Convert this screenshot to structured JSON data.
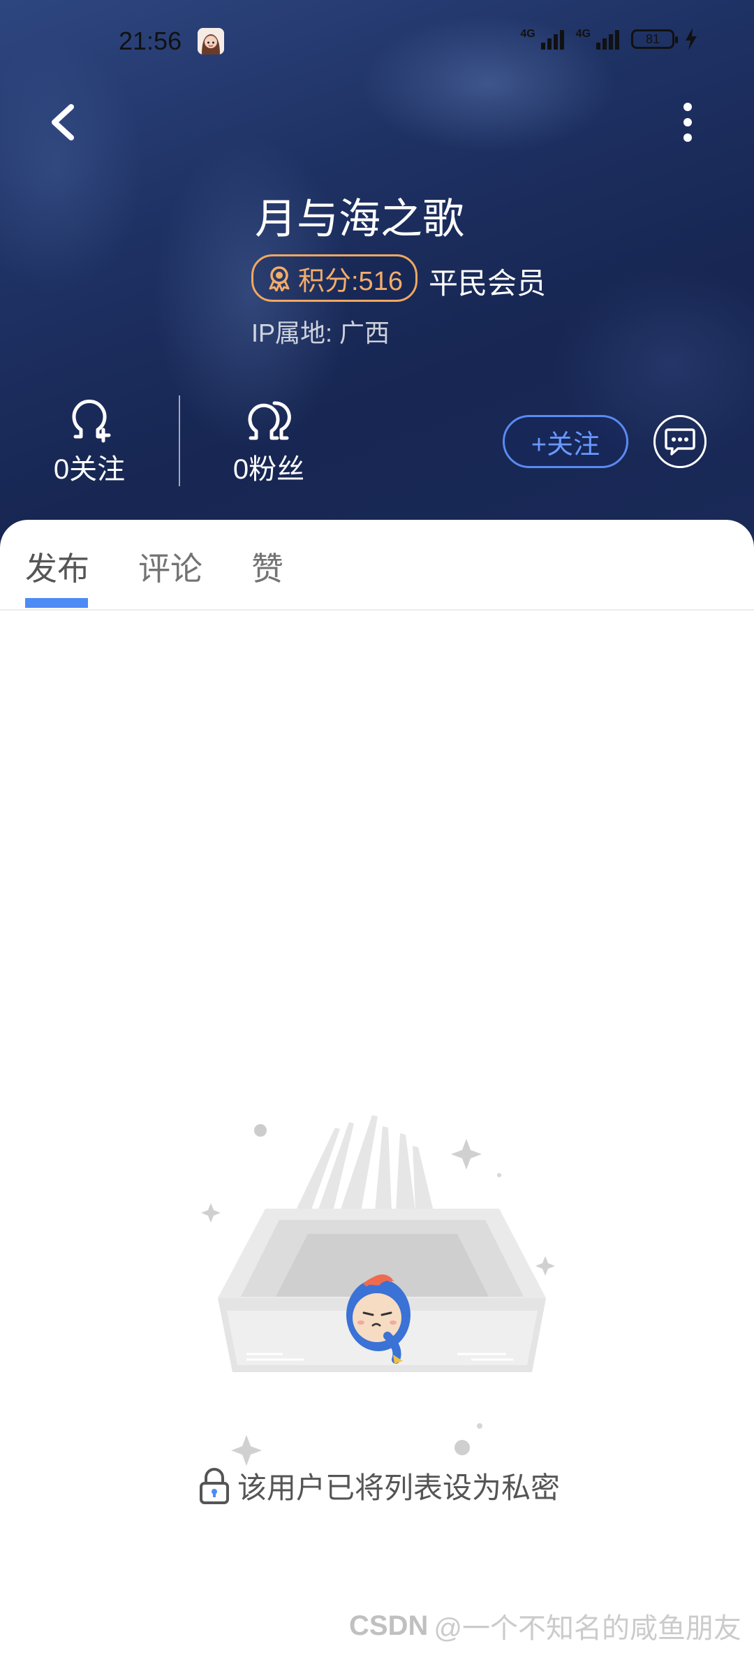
{
  "status_bar": {
    "time": "21:56",
    "network_1": "4G",
    "network_2": "4G",
    "battery": "81"
  },
  "profile": {
    "username": "月与海之歌",
    "points_label": "积分:516",
    "member_level": "平民会员",
    "ip_location": "IP属地: 广西",
    "following": "0关注",
    "fans": "0粉丝",
    "follow_button": "+关注"
  },
  "tabs": [
    {
      "label": "发布",
      "active": true
    },
    {
      "label": "评论",
      "active": false
    },
    {
      "label": "赞",
      "active": false
    }
  ],
  "empty_state": {
    "message": "该用户已将列表设为私密"
  },
  "watermark": {
    "logo": "CSDN",
    "text": "@一个不知名的咸鱼朋友"
  },
  "colors": {
    "header_bg": "#1e3163",
    "accent_blue": "#4d8bf5",
    "points_orange": "#f3ad6a"
  },
  "icons": {
    "back": "chevron-left-icon",
    "more": "more-vertical-icon",
    "points": "medal-icon",
    "following": "person-add-icon",
    "fans": "people-icon",
    "message": "chat-bubble-icon",
    "lock": "lock-icon"
  }
}
